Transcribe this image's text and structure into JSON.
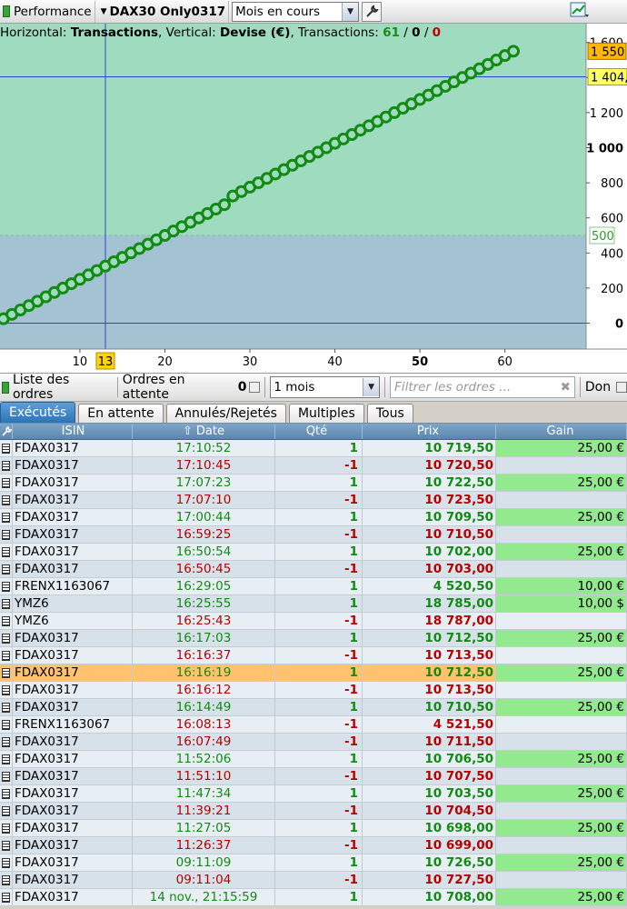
{
  "toolbar": {
    "performance_label": "Performance",
    "account_label": "DAX30 Only0317",
    "period_value": "Mois en cours"
  },
  "chart": {
    "legend": {
      "h_label": "Horizontal:",
      "h_value": "Transactions",
      "v_label": "Vertical:",
      "v_value": "Devise (€)",
      "t_label": "Transactions:",
      "t_win": "61",
      "sep1": "/",
      "t_zero": "0",
      "sep2": "/",
      "t_loss": "0"
    },
    "crosshair_x_label": "13",
    "badge_top": "1 550",
    "badge_cursor": "1 404,",
    "badge_mid": "500",
    "colors": {
      "upper_zone": "#9fdbbe",
      "lower_zone": "#a3c2d2",
      "curve": "#138a13",
      "crosshair": "#3344cc",
      "badge": "#ffd400"
    }
  },
  "chart_data": {
    "type": "line",
    "title": "",
    "xlabel": "Transactions",
    "ylabel": "Devise (€)",
    "xlim": [
      0,
      67
    ],
    "ylim": [
      -150,
      1620
    ],
    "x_ticks": [
      "10",
      "20",
      "30",
      "40",
      "50",
      "60"
    ],
    "y_ticks": [
      "0",
      "200",
      "400",
      "600",
      "800",
      "1 000",
      "1 200",
      "1 400",
      "1 600"
    ],
    "series": [
      {
        "values": [
          [
            1,
            25
          ],
          [
            2,
            50
          ],
          [
            3,
            75
          ],
          [
            4,
            100
          ],
          [
            5,
            125
          ],
          [
            6,
            150
          ],
          [
            7,
            175
          ],
          [
            8,
            200
          ],
          [
            9,
            225
          ],
          [
            10,
            250
          ],
          [
            11,
            275
          ],
          [
            12,
            300
          ],
          [
            13,
            325
          ],
          [
            14,
            350
          ],
          [
            15,
            375
          ],
          [
            16,
            400
          ],
          [
            17,
            425
          ],
          [
            18,
            450
          ],
          [
            19,
            475
          ],
          [
            20,
            500
          ],
          [
            21,
            525
          ],
          [
            22,
            550
          ],
          [
            23,
            575
          ],
          [
            24,
            600
          ],
          [
            25,
            625
          ],
          [
            26,
            650
          ],
          [
            27,
            675
          ],
          [
            28,
            725
          ],
          [
            29,
            750
          ],
          [
            30,
            775
          ],
          [
            31,
            800
          ],
          [
            32,
            825
          ],
          [
            33,
            850
          ],
          [
            34,
            875
          ],
          [
            35,
            900
          ],
          [
            36,
            925
          ],
          [
            37,
            950
          ],
          [
            38,
            975
          ],
          [
            39,
            1000
          ],
          [
            40,
            1025
          ],
          [
            41,
            1050
          ],
          [
            42,
            1075
          ],
          [
            43,
            1100
          ],
          [
            44,
            1125
          ],
          [
            45,
            1150
          ],
          [
            46,
            1175
          ],
          [
            47,
            1200
          ],
          [
            48,
            1225
          ],
          [
            49,
            1250
          ],
          [
            50,
            1275
          ],
          [
            51,
            1300
          ],
          [
            52,
            1325
          ],
          [
            53,
            1350
          ],
          [
            54,
            1375
          ],
          [
            55,
            1400
          ],
          [
            56,
            1425
          ],
          [
            57,
            1450
          ],
          [
            58,
            1475
          ],
          [
            59,
            1500
          ],
          [
            60,
            1525
          ],
          [
            61,
            1550
          ]
        ]
      }
    ],
    "reference_lines": {
      "crosshair_x": 13,
      "crosshair_y": 1404,
      "dashed_y": 500,
      "zero_y": 0
    }
  },
  "orders": {
    "list_label": "Liste des ordres",
    "pending_label": "Ordres en attente",
    "pending_count": "0",
    "period_value": "1 mois",
    "filter_placeholder": "Filtrer les ordres ...",
    "right_label": "Don"
  },
  "tabs": [
    "Exécutés",
    "En attente",
    "Annulés/Rejetés",
    "Multiples",
    "Tous"
  ],
  "table": {
    "headers": {
      "isin": "ISIN",
      "date": "Date",
      "qty": "Qté",
      "price": "Prix",
      "gain": "Gain"
    },
    "rows": [
      {
        "isin": "FDAX0317",
        "date": "17:10:52",
        "qty": "1",
        "price": "10 719,50",
        "gain": "25,00 €"
      },
      {
        "isin": "FDAX0317",
        "date": "17:10:45",
        "qty": "-1",
        "price": "10 720,50",
        "gain": ""
      },
      {
        "isin": "FDAX0317",
        "date": "17:07:23",
        "qty": "1",
        "price": "10 722,50",
        "gain": "25,00 €"
      },
      {
        "isin": "FDAX0317",
        "date": "17:07:10",
        "qty": "-1",
        "price": "10 723,50",
        "gain": ""
      },
      {
        "isin": "FDAX0317",
        "date": "17:00:44",
        "qty": "1",
        "price": "10 709,50",
        "gain": "25,00 €"
      },
      {
        "isin": "FDAX0317",
        "date": "16:59:25",
        "qty": "-1",
        "price": "10 710,50",
        "gain": ""
      },
      {
        "isin": "FDAX0317",
        "date": "16:50:54",
        "qty": "1",
        "price": "10 702,00",
        "gain": "25,00 €"
      },
      {
        "isin": "FDAX0317",
        "date": "16:50:45",
        "qty": "-1",
        "price": "10 703,00",
        "gain": ""
      },
      {
        "isin": "FRENX1163067",
        "date": "16:29:05",
        "qty": "1",
        "price": "4 520,50",
        "gain": "10,00 €"
      },
      {
        "isin": "YMZ6",
        "date": "16:25:55",
        "qty": "1",
        "price": "18 785,00",
        "gain": "10,00 $"
      },
      {
        "isin": "YMZ6",
        "date": "16:25:43",
        "qty": "-1",
        "price": "18 787,00",
        "gain": ""
      },
      {
        "isin": "FDAX0317",
        "date": "16:17:03",
        "qty": "1",
        "price": "10 712,50",
        "gain": "25,00 €"
      },
      {
        "isin": "FDAX0317",
        "date": "16:16:37",
        "qty": "-1",
        "price": "10 713,50",
        "gain": ""
      },
      {
        "isin": "FDAX0317",
        "date": "16:16:19",
        "qty": "1",
        "price": "10 712,50",
        "gain": "25,00 €",
        "selected": true
      },
      {
        "isin": "FDAX0317",
        "date": "16:16:12",
        "qty": "-1",
        "price": "10 713,50",
        "gain": ""
      },
      {
        "isin": "FDAX0317",
        "date": "16:14:49",
        "qty": "1",
        "price": "10 710,50",
        "gain": "25,00 €"
      },
      {
        "isin": "FRENX1163067",
        "date": "16:08:13",
        "qty": "-1",
        "price": "4 521,50",
        "gain": ""
      },
      {
        "isin": "FDAX0317",
        "date": "16:07:49",
        "qty": "-1",
        "price": "10 711,50",
        "gain": ""
      },
      {
        "isin": "FDAX0317",
        "date": "11:52:06",
        "qty": "1",
        "price": "10 706,50",
        "gain": "25,00 €"
      },
      {
        "isin": "FDAX0317",
        "date": "11:51:10",
        "qty": "-1",
        "price": "10 707,50",
        "gain": ""
      },
      {
        "isin": "FDAX0317",
        "date": "11:47:34",
        "qty": "1",
        "price": "10 703,50",
        "gain": "25,00 €"
      },
      {
        "isin": "FDAX0317",
        "date": "11:39:21",
        "qty": "-1",
        "price": "10 704,50",
        "gain": ""
      },
      {
        "isin": "FDAX0317",
        "date": "11:27:05",
        "qty": "1",
        "price": "10 698,00",
        "gain": "25,00 €"
      },
      {
        "isin": "FDAX0317",
        "date": "11:26:37",
        "qty": "-1",
        "price": "10 699,00",
        "gain": ""
      },
      {
        "isin": "FDAX0317",
        "date": "09:11:09",
        "qty": "1",
        "price": "10 726,50",
        "gain": "25,00 €"
      },
      {
        "isin": "FDAX0317",
        "date": "09:11:04",
        "qty": "-1",
        "price": "10 727,50",
        "gain": ""
      },
      {
        "isin": "FDAX0317",
        "date": "14 nov., 21:15:59",
        "qty": "1",
        "price": "10 708,00",
        "gain": "25,00 €"
      }
    ]
  }
}
